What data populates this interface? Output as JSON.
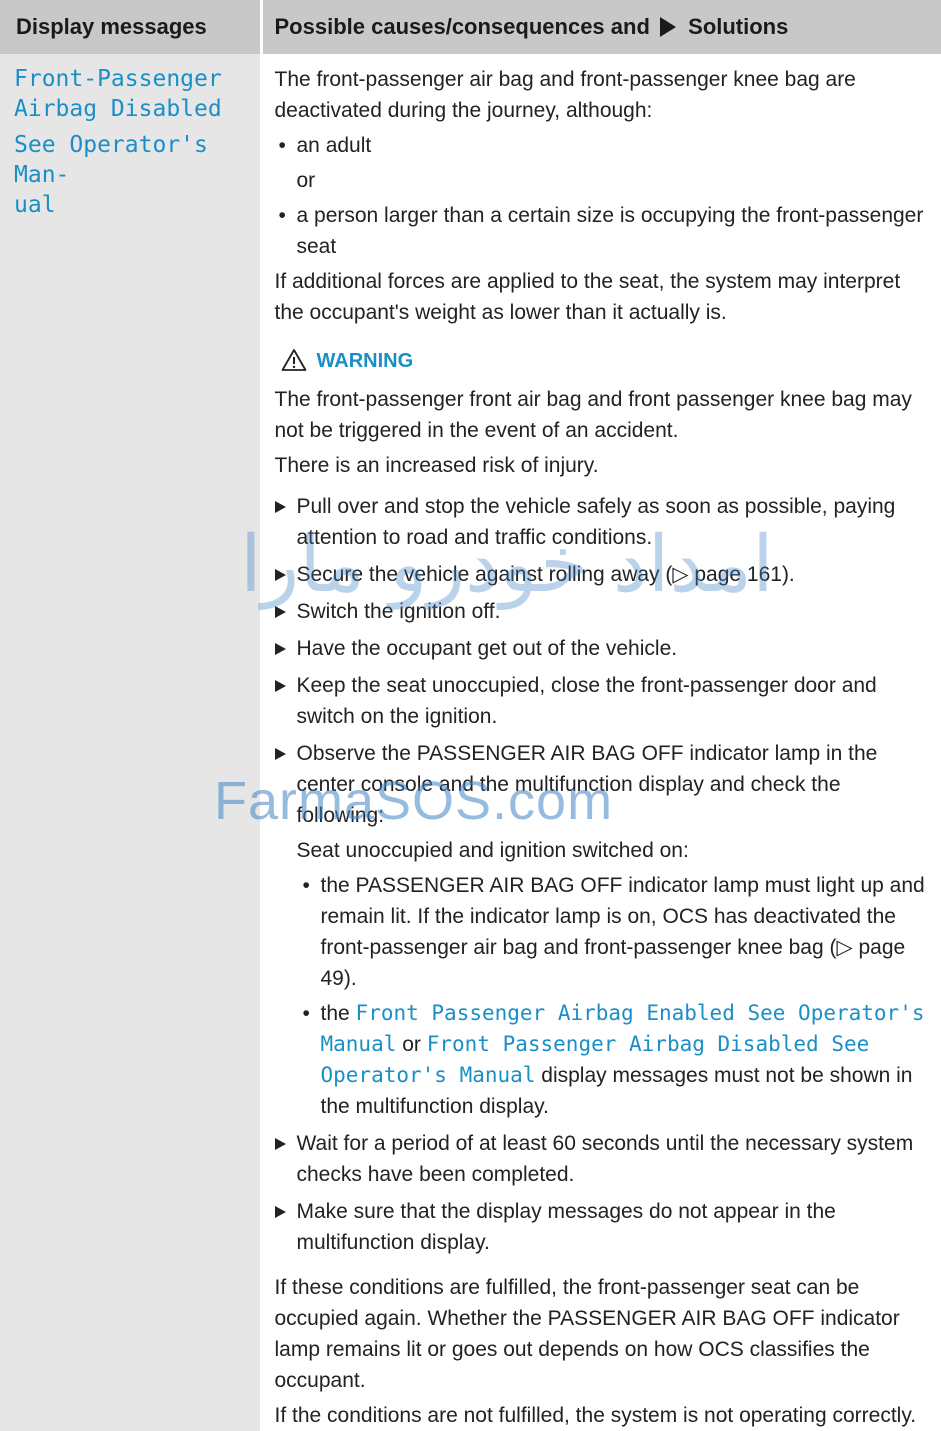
{
  "header": {
    "col1": "Display messages",
    "col2_pre": "Possible causes/consequences and",
    "col2_post": "Solutions"
  },
  "left": {
    "line1": "Front-Passenger",
    "line2": "Airbag Disabled",
    "line3": "See Operator's Man-",
    "line4": "ual"
  },
  "intro": "The front-passenger air bag and front-passenger knee bag are deactivated during the journey, although:",
  "bullet1": "an adult",
  "or": "or",
  "bullet2": "a person larger than a certain size is occupying the front-passenger seat",
  "forces": "If additional forces are applied to the seat, the system may interpret the occupant's weight as lower than it actually is.",
  "warning": {
    "label": "WARNING",
    "text1": "The front-passenger front air bag and front passenger knee bag may not be triggered in the event of an accident.",
    "text2": "There is an increased risk of injury."
  },
  "steps": [
    "Pull over and stop the vehicle safely as soon as possible, paying attention to road and traffic conditions.",
    "Secure the vehicle against rolling away (▷ page 161).",
    "Switch the ignition off.",
    "Have the occupant get out of the vehicle.",
    "Keep the seat unoccupied, close the front-passenger door and switch on the ignition.",
    "Observe the PASSENGER AIR BAG OFF indicator lamp in the center console and the multifunction display and check the following:"
  ],
  "seat_line": "Seat unoccupied and ignition switched on:",
  "sub1": "the PASSENGER AIR BAG OFF indicator lamp must light up and remain lit. If the indicator lamp is on, OCS has deactivated the front-passenger air bag and front-passenger knee bag (▷ page 49).",
  "sub2": {
    "pre": "the",
    "msg1": "Front Passenger Airbag Enabled See Operator's Manual",
    "mid": "or",
    "msg2": "Front Passenger Airbag Disabled See Operator's Manual",
    "post": "display messages must not be shown in the multifunction display."
  },
  "steps2": [
    "Wait for a period of at least 60 seconds until the necessary system checks have been completed.",
    "Make sure that the display messages do not appear in the multifunction display."
  ],
  "fulfilled": "If these conditions are fulfilled, the front-passenger seat can be occupied again. Whether the PASSENGER AIR BAG OFF indicator lamp remains lit or goes out depends on how OCS classifies the occupant.",
  "not_fulfilled": "If the conditions are not fulfilled, the system is not operating correctly.",
  "watermark": {
    "site": "FarmaSOS.com",
    "arabic": "امداد خودرو مارا"
  }
}
